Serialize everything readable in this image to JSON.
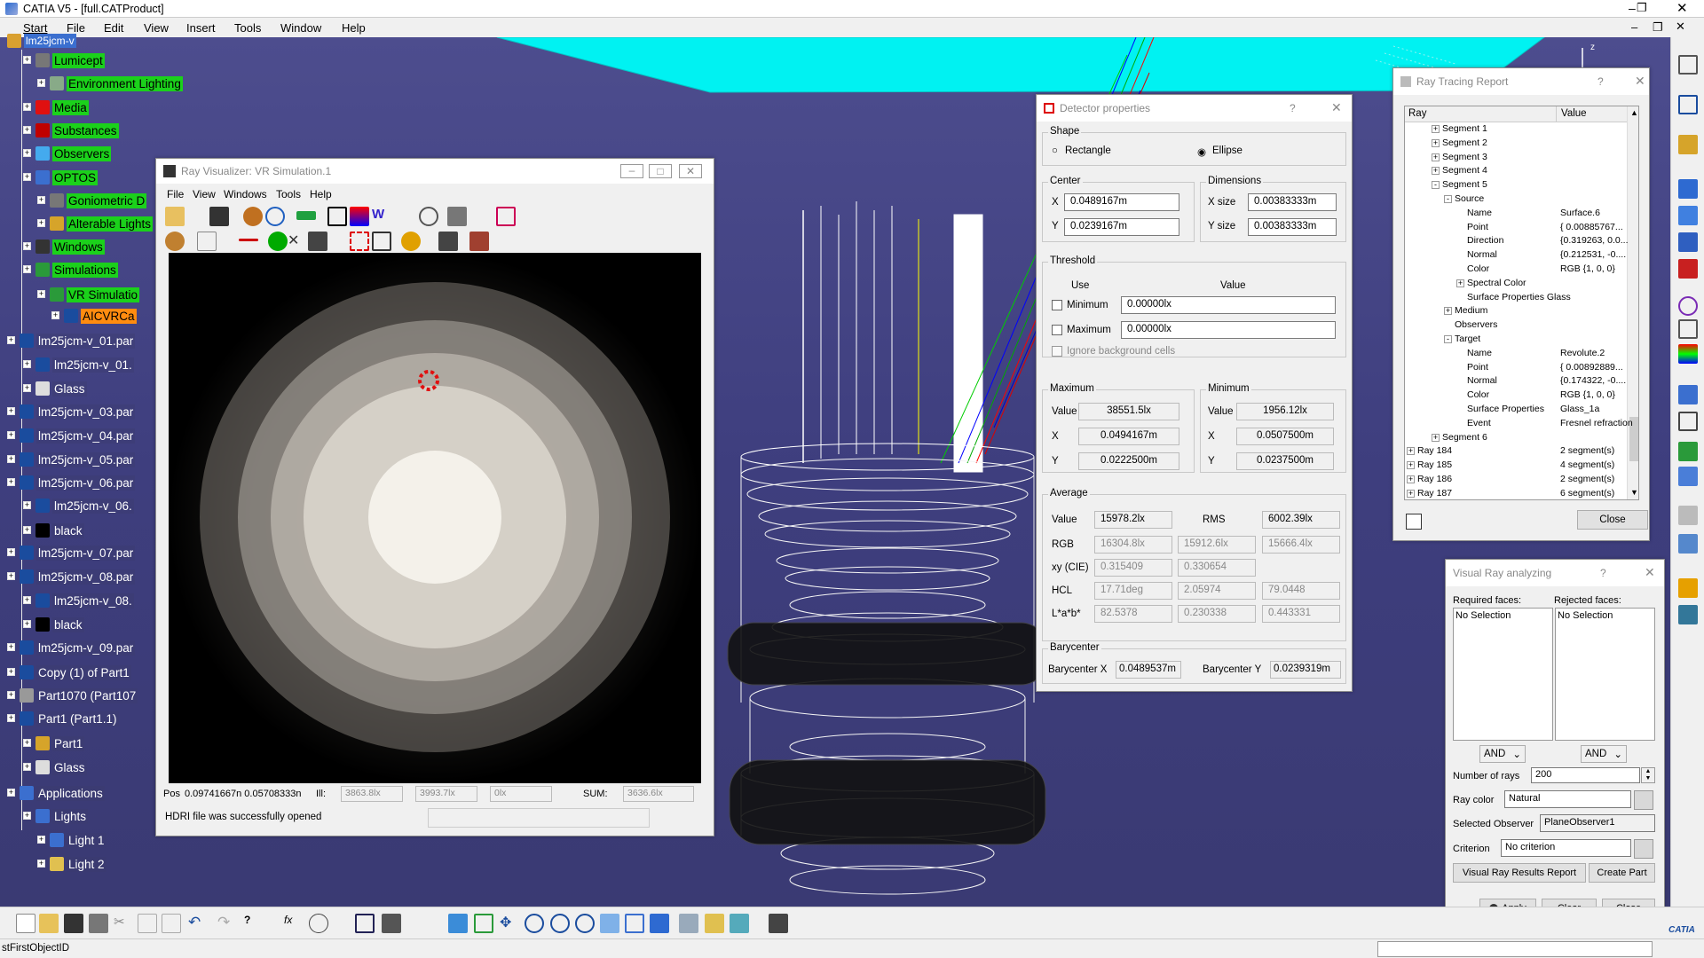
{
  "app": {
    "title": "CATIA V5 - [full.CATProduct]"
  },
  "menubar": [
    "Start",
    "File",
    "Edit",
    "View",
    "Insert",
    "Tools",
    "Window",
    "Help"
  ],
  "tree": {
    "root": "lm25jcm-v",
    "items": [
      {
        "label": "Lumicept",
        "style": "hl"
      },
      {
        "label": "Environment Lighting",
        "style": "hl"
      },
      {
        "label": "Media",
        "style": "hl"
      },
      {
        "label": "Substances",
        "style": "hl"
      },
      {
        "label": "Observers",
        "style": "hl"
      },
      {
        "label": "OPTOS",
        "style": "hl"
      },
      {
        "label": "Goniometric D",
        "style": "hl"
      },
      {
        "label": "Alterable Lights",
        "style": "hl"
      },
      {
        "label": "Windows",
        "style": "hl"
      },
      {
        "label": "Simulations",
        "style": "hl"
      },
      {
        "label": "VR Simulatio",
        "style": "hl"
      },
      {
        "label": "AICVRCa",
        "style": "or"
      },
      {
        "label": "lm25jcm-v_01.par",
        "style": "wt"
      },
      {
        "label": "lm25jcm-v_01.",
        "style": "wt"
      },
      {
        "label": "Glass",
        "style": "wt"
      },
      {
        "label": "lm25jcm-v_03.par",
        "style": "wt"
      },
      {
        "label": "lm25jcm-v_04.par",
        "style": "wt"
      },
      {
        "label": "lm25jcm-v_05.par",
        "style": "wt"
      },
      {
        "label": "lm25jcm-v_06.par",
        "style": "wt"
      },
      {
        "label": "lm25jcm-v_06.",
        "style": "wt"
      },
      {
        "label": "black",
        "style": "wt"
      },
      {
        "label": "lm25jcm-v_07.par",
        "style": "wt"
      },
      {
        "label": "lm25jcm-v_08.par",
        "style": "wt"
      },
      {
        "label": "lm25jcm-v_08.",
        "style": "wt"
      },
      {
        "label": "black",
        "style": "wt"
      },
      {
        "label": "lm25jcm-v_09.par",
        "style": "wt"
      },
      {
        "label": "Copy (1) of Part1",
        "style": "wt"
      },
      {
        "label": "Part1070 (Part107",
        "style": "wt"
      },
      {
        "label": "Part1 (Part1.1)",
        "style": "wt"
      },
      {
        "label": "Part1",
        "style": "wt"
      },
      {
        "label": "Glass",
        "style": "wt"
      },
      {
        "label": "Applications",
        "style": "wt"
      },
      {
        "label": "Lights",
        "style": "wt"
      },
      {
        "label": "Light 1",
        "style": "wt"
      },
      {
        "label": "Light 2",
        "style": "wt"
      }
    ]
  },
  "ray_visualizer": {
    "title": "Ray Visualizer: VR Simulation.1",
    "menu": [
      "File",
      "View",
      "Windows",
      "Tools",
      "Help"
    ],
    "status": {
      "pos_label": "Pos",
      "pos_value": "0.09741667n  0.05708333n",
      "ill_label": "Ill:",
      "v1": "3863.8lx",
      "v2": "3993.7lx",
      "v3": "0lx",
      "sum_label": "SUM:",
      "sum_value": "3636.6lx",
      "message": "HDRI file was successfully opened"
    }
  },
  "detector": {
    "title": "Detector properties",
    "help": "?",
    "shape": {
      "label": "Shape",
      "rect": "Rectangle",
      "ellipse": "Ellipse"
    },
    "center": {
      "label": "Center",
      "x_label": "X",
      "x": "0.0489167m",
      "y_label": "Y",
      "y": "0.0239167m"
    },
    "dimensions": {
      "label": "Dimensions",
      "xs_label": "X size",
      "xs": "0.00383333m",
      "ys_label": "Y size",
      "ys": "0.00383333m"
    },
    "threshold": {
      "label": "Threshold",
      "use": "Use",
      "value": "Value",
      "min_label": "Minimum",
      "min": "0.00000lx",
      "max_label": "Maximum",
      "max": "0.00000lx",
      "ignore": "Ignore background cells"
    },
    "maximum": {
      "label": "Maximum",
      "value_label": "Value",
      "value": "38551.5lx",
      "x_label": "X",
      "x": "0.0494167m",
      "y_label": "Y",
      "y": "0.0222500m"
    },
    "minimum": {
      "label": "Minimum",
      "value_label": "Value",
      "value": "1956.12lx",
      "x_label": "X",
      "x": "0.0507500m",
      "y_label": "Y",
      "y": "0.0237500m"
    },
    "average": {
      "label": "Average",
      "value_label": "Value",
      "value": "15978.2lx",
      "rms_label": "RMS",
      "rms": "6002.39lx",
      "rgb_label": "RGB",
      "rgb": [
        "16304.8lx",
        "15912.6lx",
        "15666.4lx"
      ],
      "xy_label": "xy (CIE)",
      "xy": [
        "0.315409",
        "0.330654"
      ],
      "hcl_label": "HCL",
      "hcl": [
        "17.71deg",
        "2.05974",
        "79.0448"
      ],
      "lab_label": "L*a*b*",
      "lab": [
        "82.5378",
        "0.230338",
        "0.443331"
      ]
    },
    "barycenter": {
      "label": "Barycenter",
      "x_label": "Barycenter X",
      "x": "0.0489537m",
      "y_label": "Barycenter Y",
      "y": "0.0239319m"
    }
  },
  "ray_report": {
    "title": "Ray Tracing Report",
    "help": "?",
    "col_ray": "Ray",
    "col_value": "Value",
    "rows": [
      {
        "ind": 3,
        "label": "Segment 1",
        "value": "",
        "exp": "+"
      },
      {
        "ind": 3,
        "label": "Segment 2",
        "value": "",
        "exp": "+"
      },
      {
        "ind": 3,
        "label": "Segment 3",
        "value": "",
        "exp": "+"
      },
      {
        "ind": 3,
        "label": "Segment 4",
        "value": "",
        "exp": "+"
      },
      {
        "ind": 3,
        "label": "Segment 5",
        "value": "",
        "exp": "-"
      },
      {
        "ind": 4,
        "label": "Source",
        "value": "",
        "exp": "-"
      },
      {
        "ind": 5,
        "label": "Name",
        "value": "Surface.6",
        "exp": ""
      },
      {
        "ind": 5,
        "label": "Point",
        "value": "{ 0.00885767...",
        "exp": ""
      },
      {
        "ind": 5,
        "label": "Direction",
        "value": "{0.319263, 0.0...",
        "exp": ""
      },
      {
        "ind": 5,
        "label": "Normal",
        "value": "{0.212531, -0....",
        "exp": ""
      },
      {
        "ind": 5,
        "label": "Color",
        "value": "RGB {1, 0, 0}",
        "exp": ""
      },
      {
        "ind": 5,
        "label": "Spectral Color",
        "value": "",
        "exp": "+"
      },
      {
        "ind": 5,
        "label": "Surface Properties Glass",
        "value": "",
        "exp": ""
      },
      {
        "ind": 4,
        "label": "Medium",
        "value": "",
        "exp": "+"
      },
      {
        "ind": 4,
        "label": "Observers",
        "value": "",
        "exp": ""
      },
      {
        "ind": 4,
        "label": "Target",
        "value": "",
        "exp": "-"
      },
      {
        "ind": 5,
        "label": "Name",
        "value": "Revolute.2",
        "exp": ""
      },
      {
        "ind": 5,
        "label": "Point",
        "value": "{ 0.00892889...",
        "exp": ""
      },
      {
        "ind": 5,
        "label": "Normal",
        "value": "{0.174322, -0....",
        "exp": ""
      },
      {
        "ind": 5,
        "label": "Color",
        "value": "RGB {1, 0, 0}",
        "exp": ""
      },
      {
        "ind": 5,
        "label": "Surface Properties",
        "value": "Glass_1a",
        "exp": ""
      },
      {
        "ind": 5,
        "label": "Event",
        "value": "Fresnel refraction",
        "exp": ""
      },
      {
        "ind": 3,
        "label": "Segment 6",
        "value": "",
        "exp": "+"
      },
      {
        "ind": 1,
        "label": "Ray 184",
        "value": "2 segment(s)",
        "exp": "+"
      },
      {
        "ind": 1,
        "label": "Ray 185",
        "value": "4 segment(s)",
        "exp": "+"
      },
      {
        "ind": 1,
        "label": "Ray 186",
        "value": "2 segment(s)",
        "exp": "+"
      },
      {
        "ind": 1,
        "label": "Ray 187",
        "value": "6 segment(s)",
        "exp": "+"
      }
    ],
    "close": "Close"
  },
  "visual_ray": {
    "title": "Visual Ray analyzing",
    "help": "?",
    "required_label": "Required faces:",
    "rejected_label": "Rejected faces:",
    "required_value": "No Selection",
    "rejected_value": "No Selection",
    "and": "AND",
    "rays_label": "Number of rays",
    "rays_value": "200",
    "color_label": "Ray color",
    "color_value": "Natural",
    "observer_label": "Selected Observer",
    "observer_value": "PlaneObserver1",
    "criterion_label": "Criterion",
    "criterion_value": "No criterion",
    "report_btn": "Visual Ray Results Report",
    "create_btn": "Create Part",
    "apply_btn": "Apply",
    "clear_btn": "Clear",
    "close_btn": "Close"
  },
  "statusbar": {
    "text": "stFirstObjectID"
  },
  "logo": "CATIA"
}
